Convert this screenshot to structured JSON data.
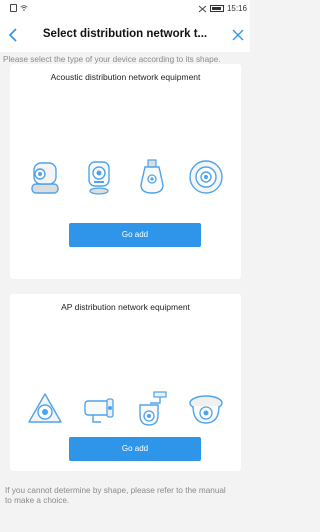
{
  "status": {
    "time": "15:16"
  },
  "header": {
    "title": "Select distribution network t..."
  },
  "hint_top": "Please select the type of your device according to its shape.",
  "sections": [
    {
      "title": "Acoustic distribution network equipment",
      "button_label": "Go add",
      "icons": [
        "pan-tilt-camera-icon",
        "cube-camera-icon",
        "bulb-camera-icon",
        "round-camera-icon"
      ]
    },
    {
      "title": "AP distribution network equipment",
      "button_label": "Go add",
      "icons": [
        "fisheye-camera-icon",
        "bullet-camera-icon",
        "ptz-dome-camera-icon",
        "dome-camera-icon"
      ]
    }
  ],
  "hint_bottom": [
    "If you cannot determine by shape, please refer to the manual",
    "to make a choice."
  ],
  "colors": {
    "accent": "#2f95e8",
    "background": "#f3f3f3"
  }
}
